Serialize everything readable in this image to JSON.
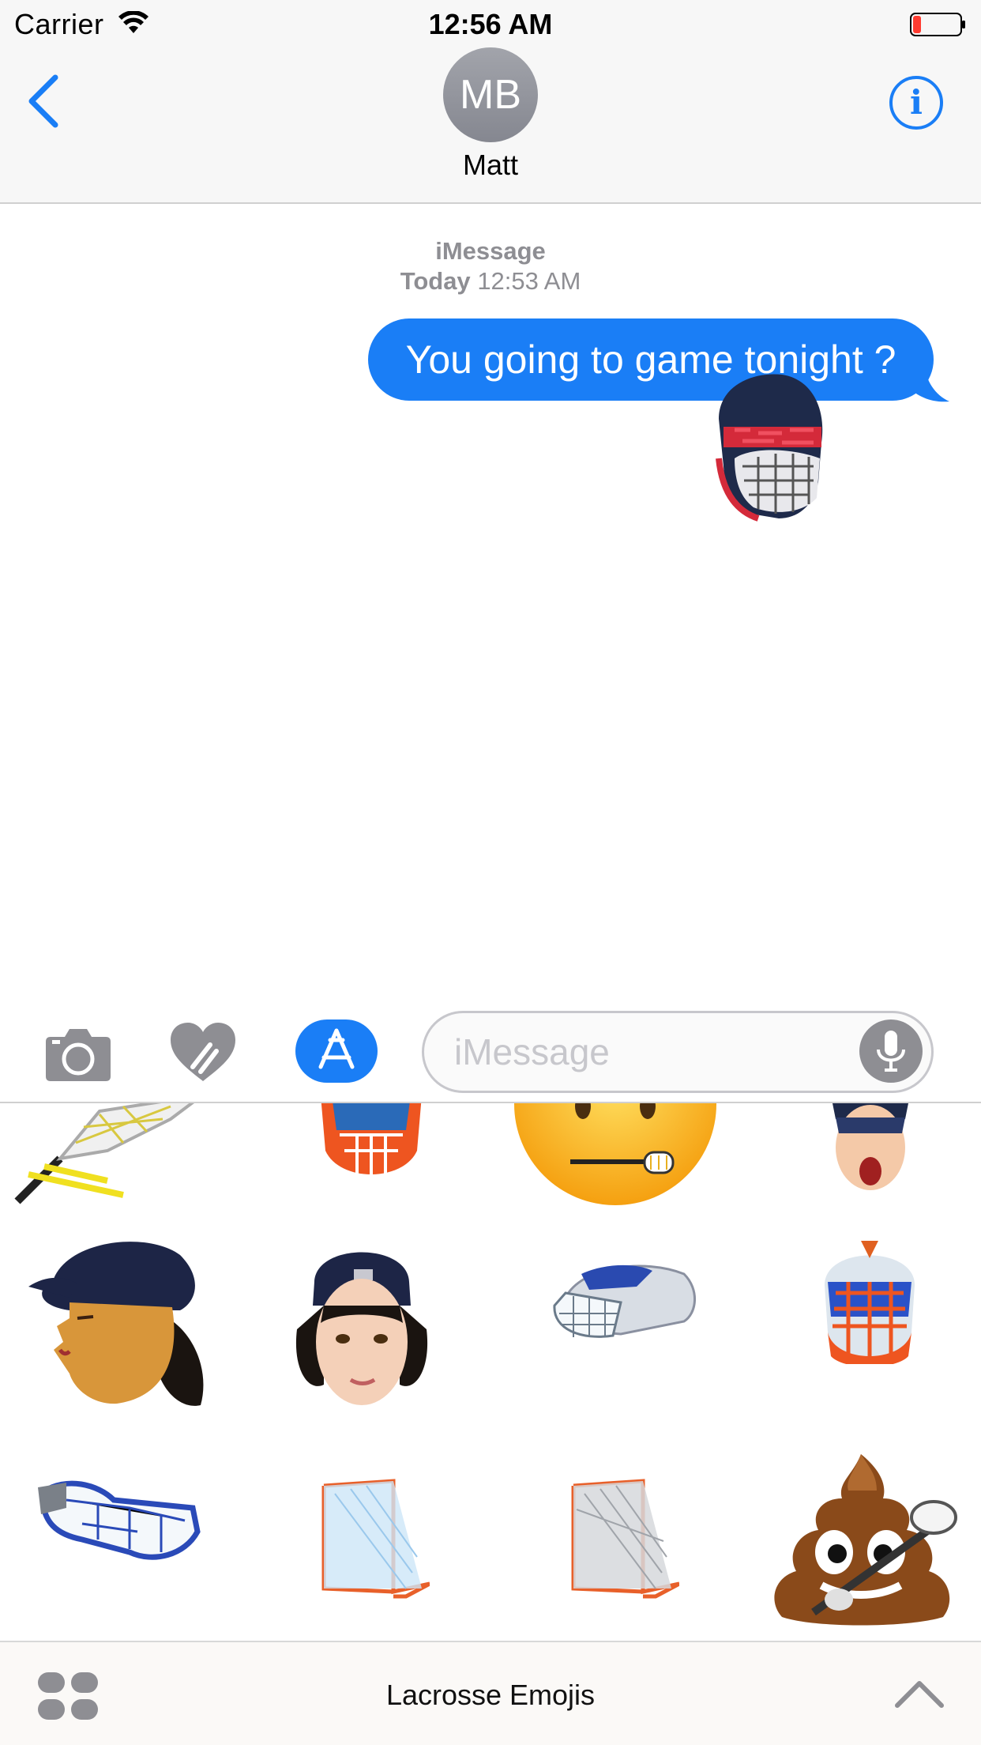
{
  "status_bar": {
    "carrier": "Carrier",
    "time": "12:56 AM",
    "icons": [
      "wifi-icon",
      "battery-icon"
    ]
  },
  "header": {
    "avatar_initials": "MB",
    "contact_name": "Matt",
    "icons": [
      "chevron-left-icon",
      "info-icon"
    ]
  },
  "conversation": {
    "service": "iMessage",
    "timestamp_day": "Today",
    "timestamp_time": "12:53 AM",
    "messages": [
      {
        "from": "me",
        "text": "You going to game tonight ?"
      }
    ],
    "stickers": [
      "lacrosse-helmet-sticker"
    ]
  },
  "input_bar": {
    "placeholder": "iMessage",
    "value": "",
    "icons": [
      "camera-icon",
      "digital-touch-heart-icon",
      "app-store-icon",
      "microphone-icon"
    ]
  },
  "sticker_drawer": {
    "rows": [
      [
        "lacrosse-stick-head",
        "goalie-helmet-orange",
        "emoji-face-stick-mouth",
        "player-face-shouting"
      ],
      [
        "player-profile-backwards-cap",
        "player-face-backwards-cap",
        "lacrosse-helmet-side",
        "goalie-helmet-front"
      ],
      [
        "lacrosse-goggles",
        "lacrosse-goal-blue",
        "lacrosse-goal-gray",
        "poop-emoji-stick"
      ]
    ]
  },
  "app_bar": {
    "title": "Lacrosse Emojis",
    "icons": [
      "app-grid-icon",
      "chevron-up-icon"
    ]
  },
  "colors": {
    "accent": "#1a7ef6",
    "avatar": "#8e8f96",
    "secondary_text": "#8e8e93",
    "battery_low": "#ff3b30"
  }
}
